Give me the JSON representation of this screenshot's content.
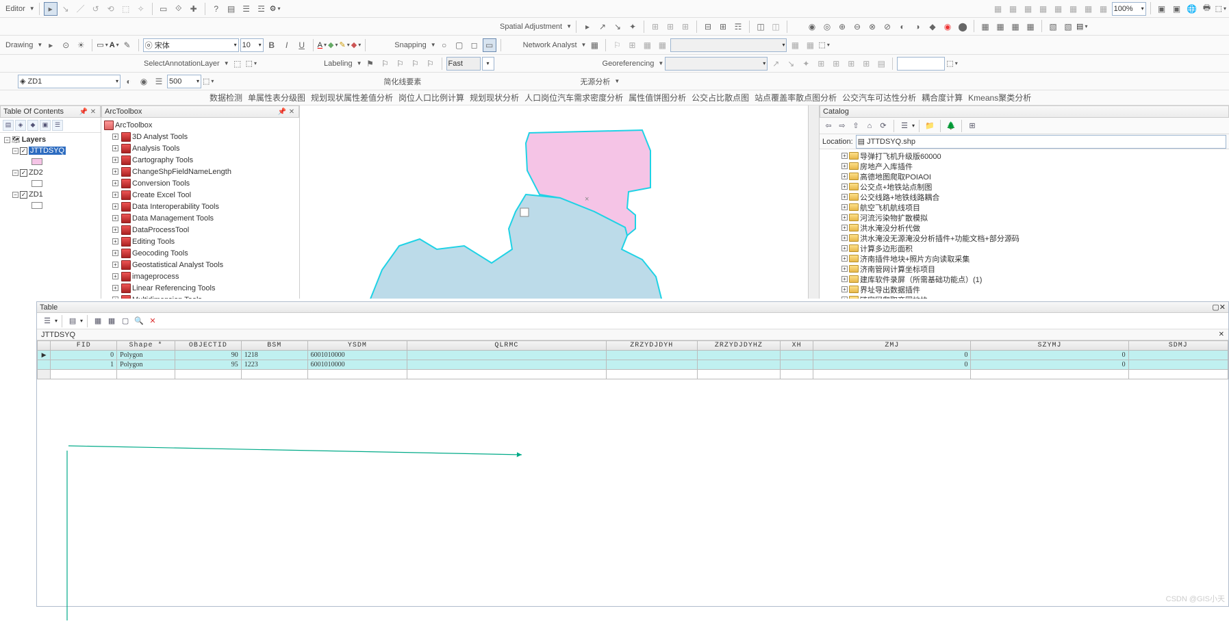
{
  "toolbars": {
    "editor": {
      "label": "Editor"
    },
    "zoom": "100%",
    "spatial": {
      "label": "Spatial Adjustment"
    },
    "drawing": {
      "label": "Drawing",
      "font": "宋体",
      "size": "10"
    },
    "snapping": {
      "label": "Snapping"
    },
    "network": {
      "label": "Network Analyst"
    },
    "selectAnno": "SelectAnnotationLayer",
    "labeling": "Labeling",
    "fast": "Fast",
    "georef": "Georeferencing",
    "layerCombo": "ZD1",
    "scaleCombo": "500",
    "simplify": "简化线要素",
    "wuyuan": "无源分析"
  },
  "analysis": [
    "数据检测",
    "单属性表分级图",
    "规划现状属性差值分析",
    "岗位人口比例计算",
    "规划现状分析",
    "人口岗位汽车需求密度分析",
    "属性值饼图分析",
    "公交占比散点图",
    "站点覆盖率散点图分析",
    "公交汽车可达性分析",
    "耦合度计算",
    "Kmeans聚类分析"
  ],
  "toc": {
    "title": "Table Of Contents",
    "root": "Layers",
    "layers": [
      {
        "name": "JTTDSYQ",
        "checked": true,
        "selected": true,
        "swatch": "#f5c4e6"
      },
      {
        "name": "ZD2",
        "checked": true,
        "swatch": "#ffffff"
      },
      {
        "name": "ZD1",
        "checked": true,
        "swatch": "#ffffff"
      }
    ]
  },
  "arctoolbox": {
    "title": "ArcToolbox",
    "root": "ArcToolbox",
    "tools": [
      "3D Analyst Tools",
      "Analysis Tools",
      "Cartography Tools",
      "ChangeShpFieldNameLength",
      "Conversion Tools",
      "Create Excel Tool",
      "Data Interoperability Tools",
      "Data Management Tools",
      "DataProcessTool",
      "Editing Tools",
      "Geocoding Tools",
      "Geostatistical Analyst Tools",
      "imageprocess",
      "Linear Referencing Tools",
      "Multidimension Tools"
    ]
  },
  "catalog": {
    "title": "Catalog",
    "locationLabel": "Location:",
    "location": "JTTDSYQ.shp",
    "folders": [
      "导弹打飞机升级版60000",
      "房地产入库插件",
      "高德地图爬取POIAOI",
      "公交点+地铁站点制图",
      "公交线路+地铁线路耦合",
      "航空飞机航线项目",
      "河流污染物扩散模拟",
      "洪水淹没分析代做",
      "洪水淹没无源淹没分析插件+功能文档+部分源码",
      "计算多边形面积",
      "济南插件地块+照片方向读取采集",
      "济南管网计算坐标项目",
      "建库软件录屏（所需基础功能点）(1)",
      "界址导出数据插件",
      "链家网爬取商圈地块"
    ]
  },
  "table": {
    "title": "Table",
    "layer": "JTTDSYQ",
    "cols": [
      "FID",
      "Shape *",
      "OBJECTID",
      "BSM",
      "YSDM",
      "QLRMC",
      "ZRZYDJDYH",
      "ZRZYDJDYHZ",
      "XH",
      "ZMJ",
      "SZYMJ",
      "SDMJ"
    ],
    "rows": [
      {
        "FID": "0",
        "Shape": "Polygon",
        "OBJECTID": "90",
        "BSM": "1218",
        "YSDM": "6001010000",
        "QLRMC": "",
        "ZRZYDJDYH": "",
        "ZRZYDJDYHZ": "",
        "XH": "",
        "ZMJ": "0",
        "SZYMJ": "0",
        "SDMJ": ""
      },
      {
        "FID": "1",
        "Shape": "Polygon",
        "OBJECTID": "95",
        "BSM": "1223",
        "YSDM": "6001010000",
        "QLRMC": "",
        "ZRZYDJDYH": "",
        "ZRZYDJDYHZ": "",
        "XH": "",
        "ZMJ": "0",
        "SZYMJ": "0",
        "SDMJ": ""
      }
    ]
  },
  "watermark": "CSDN @GIS小天"
}
